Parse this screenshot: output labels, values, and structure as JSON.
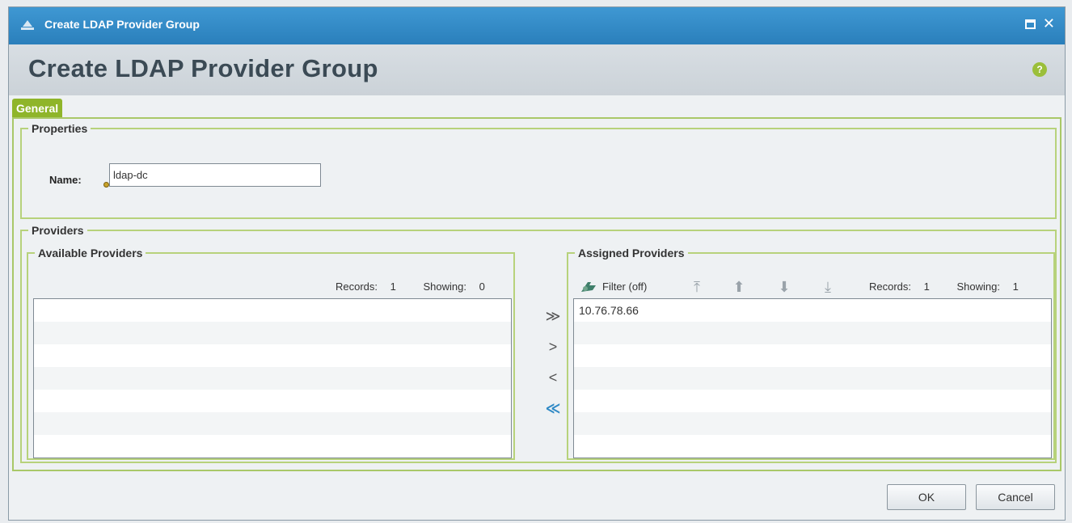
{
  "window": {
    "title": "Create LDAP Provider Group",
    "heading": "Create LDAP Provider Group",
    "help_glyph": "?"
  },
  "tabs": [
    {
      "label": "General"
    }
  ],
  "properties": {
    "legend": "Properties",
    "name_label": "Name:",
    "name_value": "ldap-dc"
  },
  "providers": {
    "legend": "Providers",
    "available": {
      "legend": "Available Providers",
      "records_label": "Records:",
      "records_value": "1",
      "showing_label": "Showing:",
      "showing_value": "0",
      "rows": []
    },
    "assigned": {
      "legend": "Assigned Providers",
      "filter_label": "Filter (off)",
      "records_label": "Records:",
      "records_value": "1",
      "showing_label": "Showing:",
      "showing_value": "1",
      "rows": [
        "10.76.78.66"
      ]
    },
    "move_buttons": {
      "add_all": "≫",
      "add": ">",
      "remove": "<",
      "remove_all": "≪"
    }
  },
  "footer": {
    "ok_label": "OK",
    "cancel_label": "Cancel"
  },
  "colors": {
    "titlebar": "#2f89c5",
    "accent_green": "#8fb52a",
    "border_green": "#b7d27b"
  }
}
